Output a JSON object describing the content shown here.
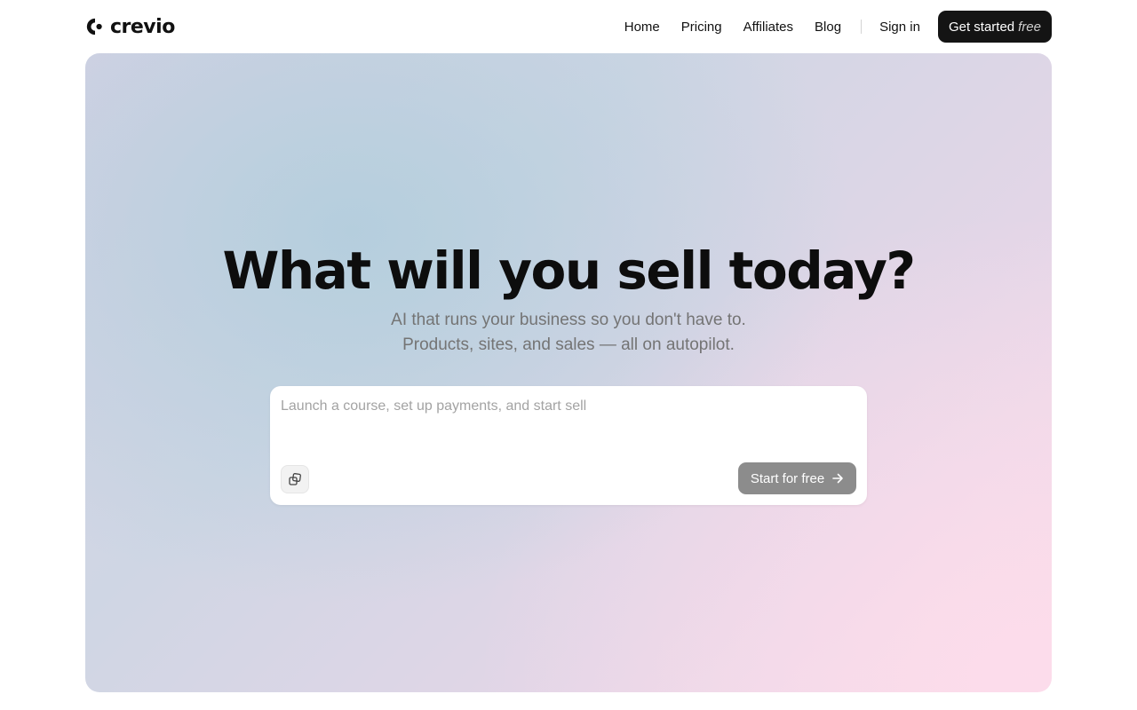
{
  "brand": {
    "name": "crevio",
    "logo_icon": "crevio-logo-icon"
  },
  "nav": {
    "links": [
      {
        "label": "Home"
      },
      {
        "label": "Pricing"
      },
      {
        "label": "Affiliates"
      },
      {
        "label": "Blog"
      }
    ],
    "signin_label": "Sign in",
    "cta_label": "Get started",
    "cta_emphasis": "free"
  },
  "hero": {
    "headline": "What will you sell today?",
    "subline_1": "AI that runs your business so you don't have to.",
    "subline_2": "Products, sites, and sales — all on autopilot."
  },
  "prompt": {
    "placeholder": "Launch a course, set up payments, and start sell",
    "value": "",
    "attach_icon": "attachment-icon",
    "submit_label": "Start for free",
    "submit_icon": "arrow-right-icon"
  },
  "colors": {
    "cta_bg": "#141414",
    "submit_bg": "#8c8c8c",
    "hero_left": "#b0cddc",
    "hero_right": "#fddceb"
  }
}
